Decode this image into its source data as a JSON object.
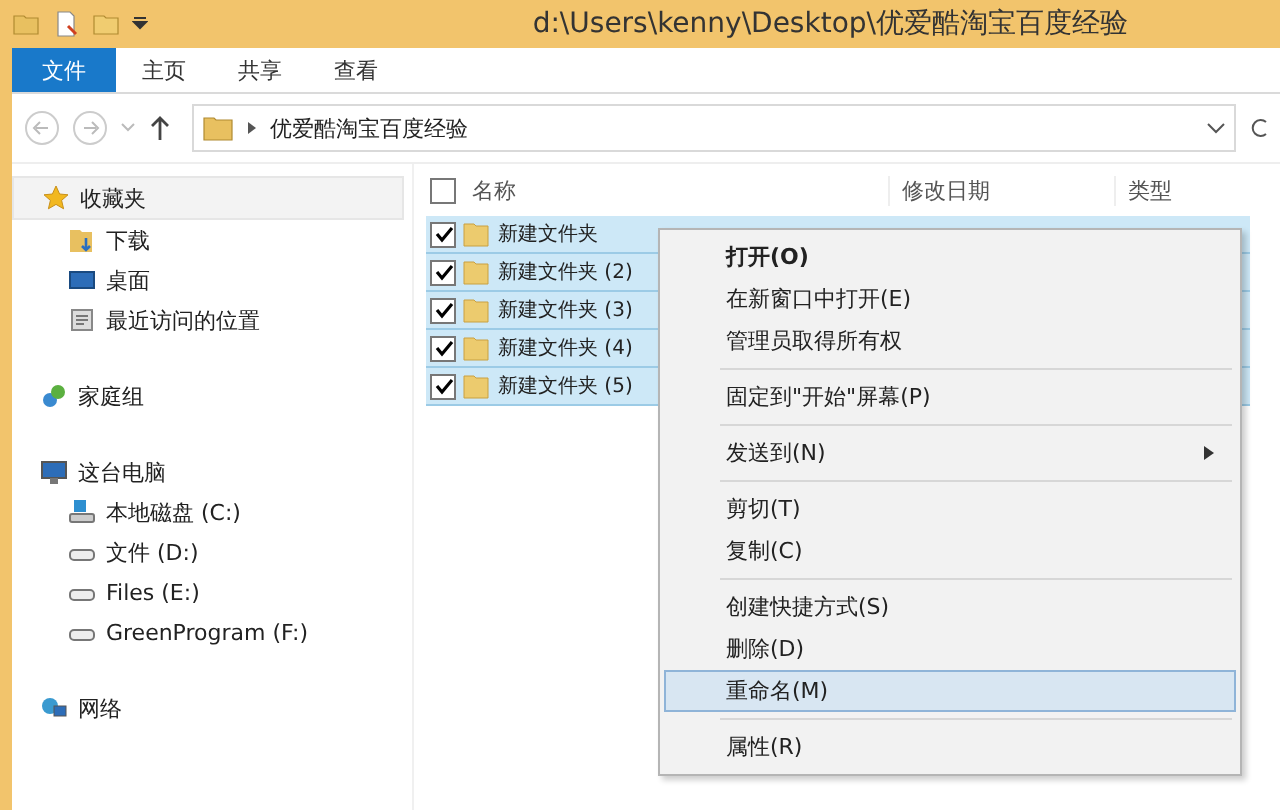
{
  "window": {
    "title": "d:\\Users\\kenny\\Desktop\\优爱酷淘宝百度经验"
  },
  "ribbon_tabs": [
    {
      "label": "文件",
      "kind": "file",
      "selected": false
    },
    {
      "label": "主页",
      "kind": "tab",
      "selected": false
    },
    {
      "label": "共享",
      "kind": "tab",
      "selected": false
    },
    {
      "label": "查看",
      "kind": "tab",
      "selected": false
    }
  ],
  "address_bar": {
    "path": "优爱酷淘宝百度经验"
  },
  "sidebar": {
    "items": [
      {
        "label": "收藏夹",
        "kind": "star",
        "selected": true,
        "children": [
          {
            "label": "下载",
            "kind": "download",
            "selected": false
          },
          {
            "label": "桌面",
            "kind": "desktop",
            "selected": false
          },
          {
            "label": "最近访问的位置",
            "kind": "recent",
            "selected": false
          }
        ]
      },
      {
        "label": "家庭组",
        "kind": "homegroup",
        "selected": false
      },
      {
        "label": "这台电脑",
        "kind": "pc",
        "selected": false,
        "children": [
          {
            "label": "本地磁盘 (C:)",
            "kind": "disk",
            "selected": false
          },
          {
            "label": "文件 (D:)",
            "kind": "drive",
            "selected": false
          },
          {
            "label": "Files (E:)",
            "kind": "drive",
            "selected": false
          },
          {
            "label": "GreenProgram (F:)",
            "kind": "drive",
            "selected": false
          }
        ]
      },
      {
        "label": "网络",
        "kind": "network",
        "selected": false
      }
    ]
  },
  "file_list": {
    "select_all_checked": false,
    "columns": [
      "名称",
      "修改日期",
      "类型"
    ],
    "rows": [
      {
        "name": "新建文件夹",
        "checked": true,
        "selected": true
      },
      {
        "name": "新建文件夹 (2)",
        "checked": true,
        "selected": true
      },
      {
        "name": "新建文件夹 (3)",
        "checked": true,
        "selected": true
      },
      {
        "name": "新建文件夹 (4)",
        "checked": true,
        "selected": true
      },
      {
        "name": "新建文件夹 (5)",
        "checked": true,
        "selected": true
      }
    ]
  },
  "context_menu": {
    "groups": [
      [
        {
          "label": "打开(O)",
          "kind": "default",
          "selected": false
        },
        {
          "label": "在新窗口中打开(E)",
          "kind": "item",
          "selected": false
        },
        {
          "label": "管理员取得所有权",
          "kind": "item",
          "selected": false
        }
      ],
      [
        {
          "label": "固定到\"开始\"屏幕(P)",
          "kind": "item",
          "selected": false
        }
      ],
      [
        {
          "label": "发送到(N)",
          "kind": "submenu",
          "selected": false
        }
      ],
      [
        {
          "label": "剪切(T)",
          "kind": "item",
          "selected": false
        },
        {
          "label": "复制(C)",
          "kind": "item",
          "selected": false
        }
      ],
      [
        {
          "label": "创建快捷方式(S)",
          "kind": "item",
          "selected": false
        },
        {
          "label": "删除(D)",
          "kind": "item",
          "selected": false
        },
        {
          "label": "重命名(M)",
          "kind": "item",
          "selected": true
        }
      ],
      [
        {
          "label": "属性(R)",
          "kind": "item",
          "selected": false
        }
      ]
    ]
  }
}
